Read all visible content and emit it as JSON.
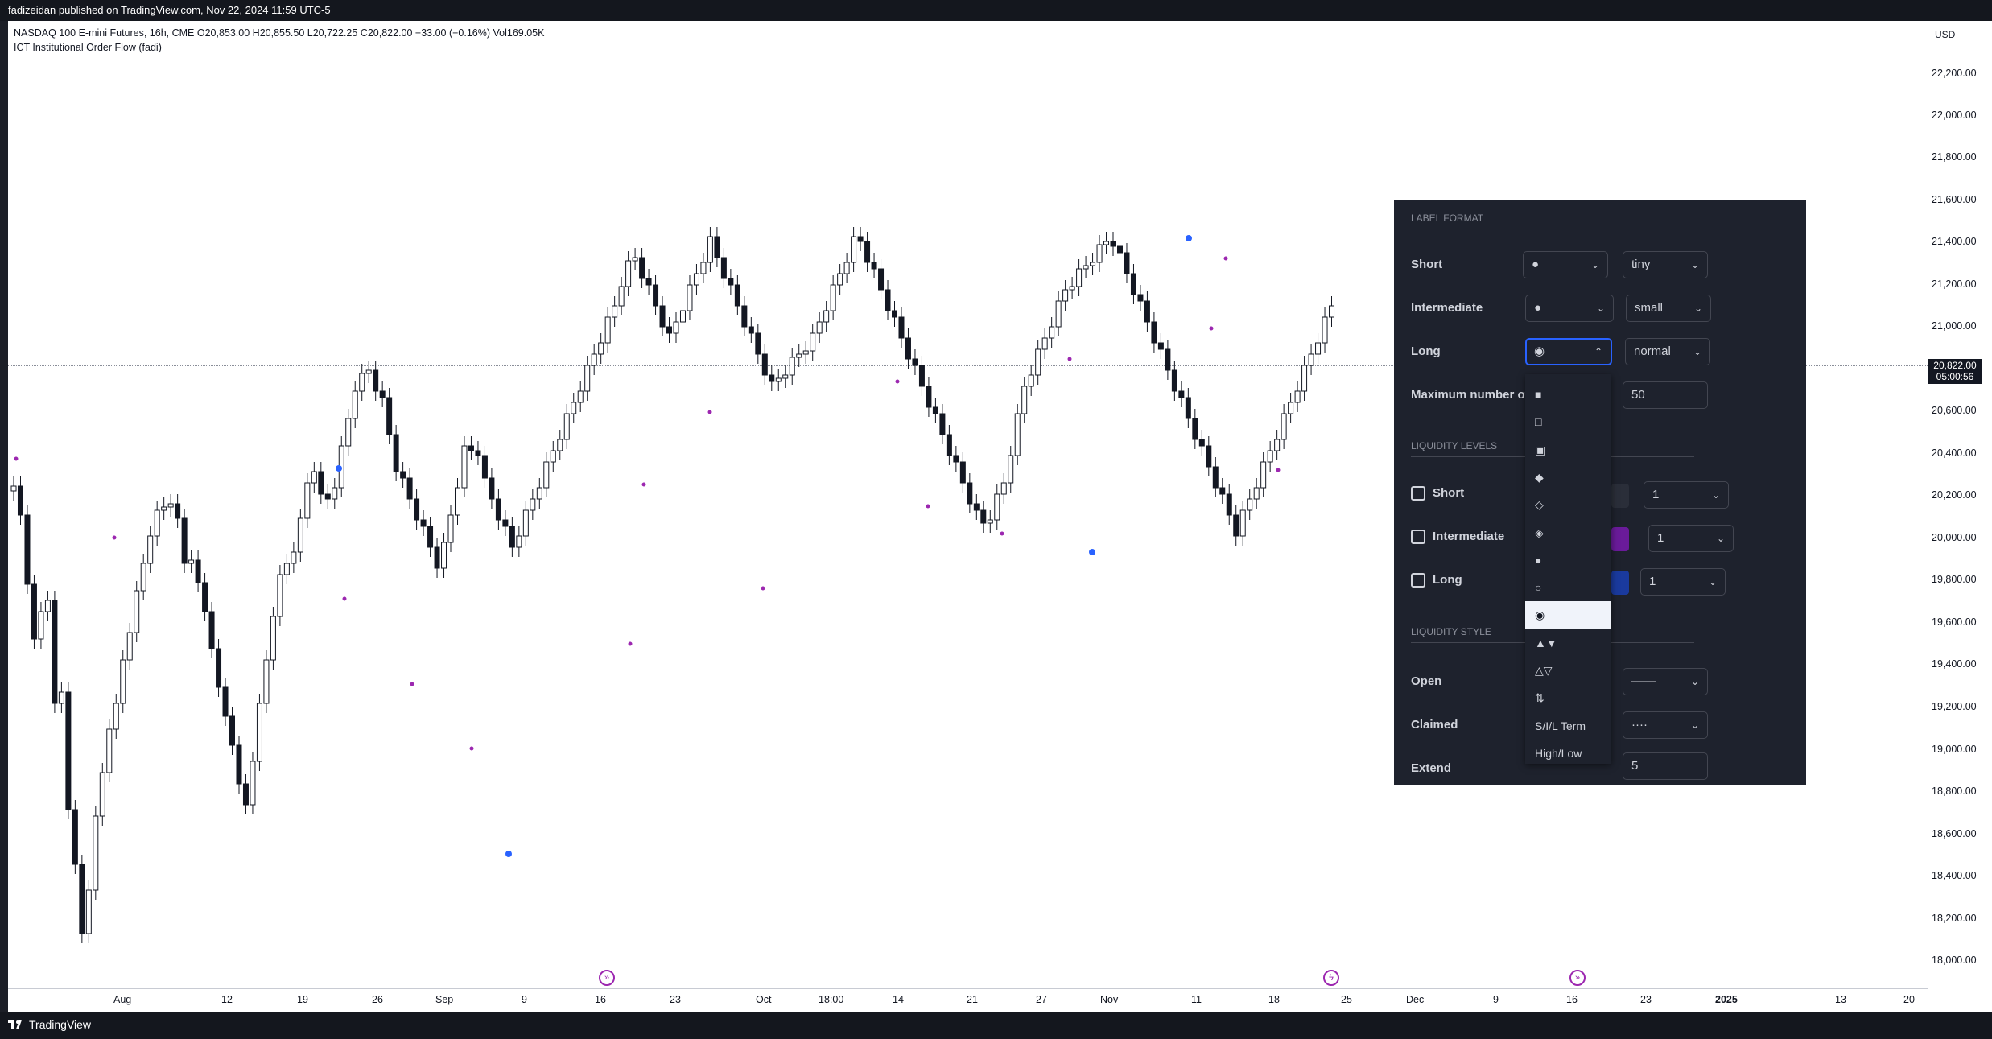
{
  "topbar": {
    "text": "fadizeidan published on TradingView.com, Nov 22, 2024 11:59 UTC-5"
  },
  "legend": {
    "symbol_line": "NASDAQ 100 E-mini Futures, 16h, CME  O20,853.00  H20,855.50  L20,722.25  C20,822.00  −33.00 (−0.16%)  Vol169.05K",
    "indicator_line": "ICT Institutional Order Flow (fadi)"
  },
  "price_axis": {
    "currency": "USD",
    "labels": [
      "22,200.00",
      "22,000.00",
      "21,800.00",
      "21,600.00",
      "21,400.00",
      "21,200.00",
      "21,000.00",
      "20,600.00",
      "20,400.00",
      "20,200.00",
      "20,000.00",
      "19,800.00",
      "19,600.00",
      "19,400.00",
      "19,200.00",
      "19,000.00",
      "18,800.00",
      "18,600.00",
      "18,400.00",
      "18,200.00",
      "18,000.00"
    ],
    "current_price": "20,822.00",
    "countdown": "05:00:56"
  },
  "time_axis": {
    "labels": [
      "Aug",
      "12",
      "19",
      "26",
      "Sep",
      "9",
      "16",
      "23",
      "Oct",
      "18:00",
      "14",
      "21",
      "27",
      "Nov",
      "11",
      "18",
      "25",
      "Dec",
      "9",
      "16",
      "23",
      "2025",
      "13",
      "20"
    ]
  },
  "bottombar": {
    "brand": "TradingView"
  },
  "panel": {
    "label_format": {
      "title": "LABEL FORMAT",
      "rows": [
        {
          "label": "Short",
          "shape": "●",
          "size": "tiny"
        },
        {
          "label": "Intermediate",
          "shape": "●",
          "size": "small"
        },
        {
          "label": "Long",
          "shape": "◉",
          "size": "normal"
        }
      ],
      "max_label": "Maximum number of",
      "max_value": "50"
    },
    "liquidity_levels": {
      "title": "LIQUIDITY LEVELS",
      "rows": [
        {
          "label": "Short",
          "width": "1"
        },
        {
          "label": "Intermediate",
          "width": "1"
        },
        {
          "label": "Long",
          "width": "1"
        }
      ]
    },
    "liquidity_style": {
      "title": "LIQUIDITY STYLE",
      "rows": [
        {
          "label": "Open",
          "value": "——"
        },
        {
          "label": "Claimed",
          "value": "····"
        },
        {
          "label": "Extend",
          "value": "5"
        }
      ]
    },
    "dropdown_options": [
      "■",
      "□",
      "▣",
      "◆",
      "◇",
      "◈",
      "●",
      "○",
      "◉",
      "▲▼",
      "△▽",
      "⇅",
      "S/I/L Term",
      "High/Low"
    ],
    "dropdown_selected": "◉"
  },
  "colors": {
    "panel_bg": "#1e222d",
    "accent": "#2962ff",
    "marker_purple": "#9c27b0",
    "marker_blue": "#2962ff"
  }
}
